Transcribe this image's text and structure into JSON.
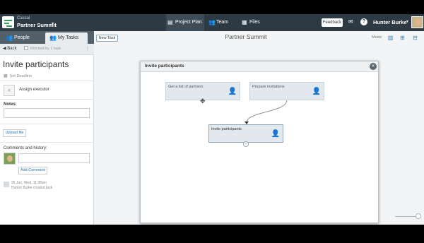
{
  "topbar": {
    "project_sub": "Cassal",
    "project_name": "Partner Summit",
    "nav": {
      "project_plan": "Project Plan",
      "team": "Team",
      "files": "Files"
    },
    "feedback": "Feedback",
    "user_name": "Hunter Burke"
  },
  "left_panel": {
    "tabs": {
      "people": "People",
      "my_tasks": "My Tasks"
    },
    "back": "Back",
    "blocked": "Blocked by 1 task",
    "task_title": "Invite participants",
    "set_deadline": "Set Deadline",
    "assign_executor": "Assign executor",
    "notes_label": "Notes:",
    "upload_file": "Upload file",
    "comments_label": "Comments and history:",
    "add_comment": "Add Comment",
    "history": {
      "date": "26 Jun, Wed, 11:38am",
      "text": "Hunter Burke created task"
    }
  },
  "main": {
    "new_task": "New Task",
    "title": "Partner Summit",
    "mode_label": "Mode:"
  },
  "modal": {
    "title": "Invite participants",
    "nodes": [
      {
        "label": "Get a list of partners"
      },
      {
        "label": "Prepare invitations"
      },
      {
        "label": "Invite participants"
      }
    ]
  },
  "icons": {
    "accent": "#2a7fc1",
    "topbar_bg": "#2d3a44"
  }
}
